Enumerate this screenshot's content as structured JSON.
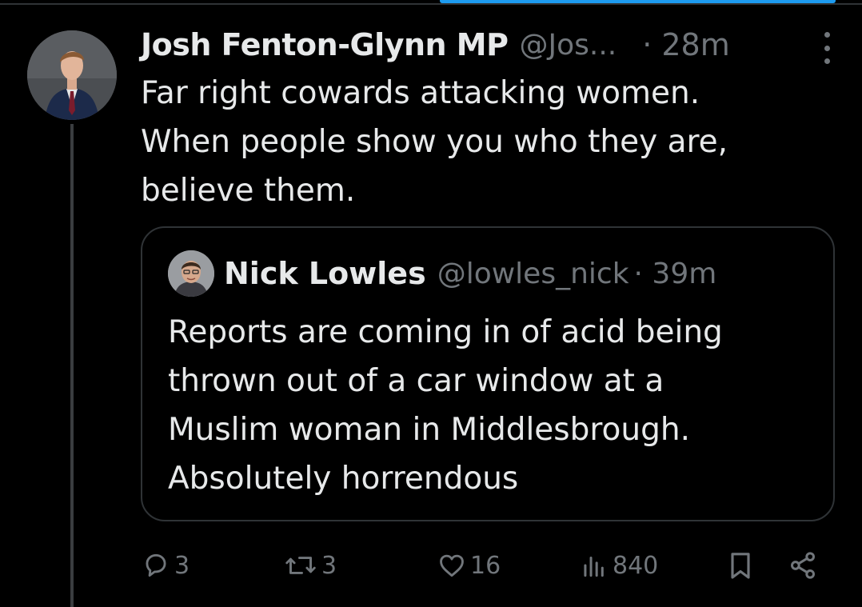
{
  "tweet": {
    "author_name": "Josh Fenton-Glynn MP",
    "author_handle": "@Jos...",
    "time": "· 28m",
    "text": "Far right cowards attacking women.\nWhen people show you who they are,\nbelieve them."
  },
  "quoted_tweet": {
    "author_name": "Nick Lowles",
    "author_handle": "@lowles_nick",
    "time": "· 39m",
    "text": "Reports are coming in of acid being\nthrown out of a car window at a\nMuslim woman in Middlesbrough.\nAbsolutely horrendous"
  },
  "actions": {
    "replies": "3",
    "reposts": "3",
    "likes": "16",
    "views": "840"
  },
  "icons": {
    "reply": "reply-icon",
    "repost": "repost-icon",
    "like": "heart-icon",
    "views": "views-icon",
    "bookmark": "bookmark-icon",
    "share": "share-icon",
    "more": "more-icon"
  },
  "colors": {
    "background": "#000000",
    "text": "#e7e9ea",
    "secondary": "#71767b",
    "border": "#2f3336",
    "accent": "#1d9bf0"
  }
}
